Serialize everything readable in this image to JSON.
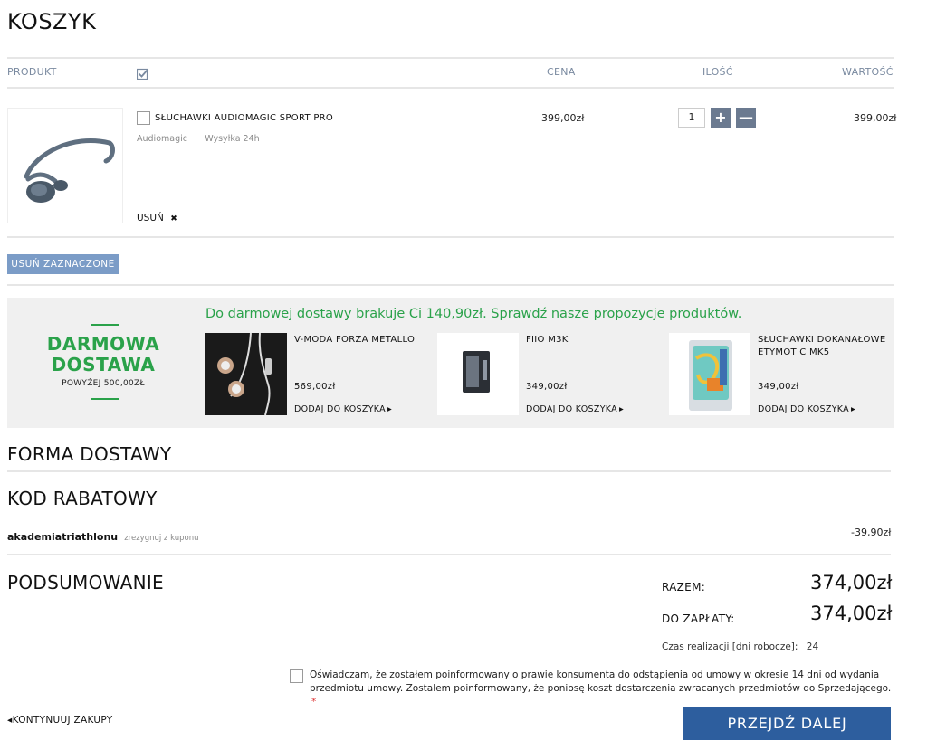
{
  "cart": {
    "title": "KOSZYK",
    "columns": {
      "product": "PRODUKT",
      "price": "CENA",
      "qty": "ILOŚĆ",
      "value": "WARTOŚĆ"
    },
    "item": {
      "name": "SŁUCHAWKI AUDIOMAGIC SPORT PRO",
      "brand": "Audiomagic",
      "separator": "|",
      "shipping": "Wysyłka 24h",
      "price": "399,00zł",
      "qty": "1",
      "value": "399,00zł",
      "remove_label": "USUŃ",
      "remove_icon": "✖"
    },
    "plus": "+",
    "minus": "—",
    "remove_selected": "USUŃ ZAZNACZONE"
  },
  "promo": {
    "title_line1": "DARMOWA",
    "title_line2": "DOSTAWA",
    "subtitle": "POWYŻEJ 500,00ZŁ",
    "headline": "Do darmowej dostawy brakuje Ci 140,90zł. Sprawdź nasze propozycje produktów.",
    "products": [
      {
        "name": "V-MODA FORZA METALLO",
        "price": "569,00zł",
        "add": "DODAJ DO KOSZYKA"
      },
      {
        "name": "FIIO M3K",
        "price": "349,00zł",
        "add": "DODAJ DO KOSZYKA"
      },
      {
        "name": "SŁUCHAWKI DOKANAŁOWE ETYMOTIC MK5",
        "price": "349,00zł",
        "add": "DODAJ DO KOSZYKA"
      }
    ],
    "arrow": "▸",
    "colors": {
      "green": "#2aa24a",
      "bg": "#f0f0f0"
    }
  },
  "delivery": {
    "title": "FORMA DOSTAWY"
  },
  "discount": {
    "title": "KOD RABATOWY",
    "code": "akademiatriathlonu",
    "resign": "zrezygnuj z kuponu",
    "amount": "-39,90zł"
  },
  "summary": {
    "title": "PODSUMOWANIE",
    "total_label": "RAZEM:",
    "total": "374,00zł",
    "pay_label": "DO ZAPŁATY:",
    "pay": "374,00zł",
    "time_label": "Czas realizacji [dni robocze]:",
    "time_value": "24"
  },
  "consent": {
    "text": "Oświadczam, że zostałem poinformowany o prawie konsumenta do odstąpienia od umowy w okresie 14 dni od wydania przedmiotu umowy. Zostałem poinformowany, że poniosę koszt dostarczenia zwracanych przedmiotów do Sprzedającego.",
    "required": "*"
  },
  "nav": {
    "continue_arrow": "◂",
    "continue": "KONTYNUUJ ZAKUPY",
    "next": "PRZEJDŹ DALEJ"
  },
  "icons": {
    "check_all": "check-icon",
    "remove": "close-icon"
  }
}
